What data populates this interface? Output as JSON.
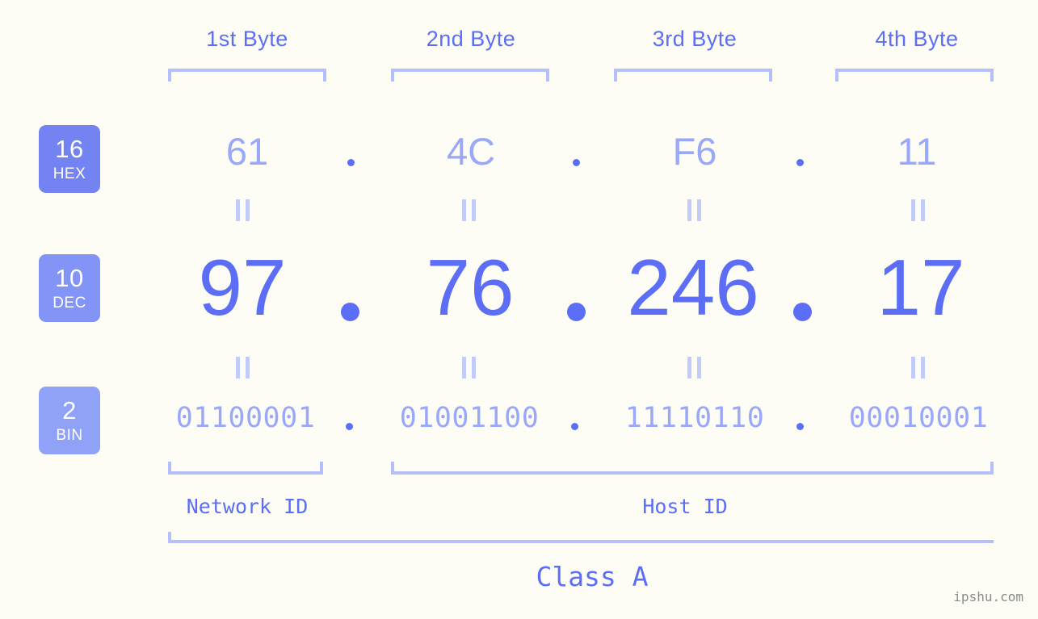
{
  "colors": {
    "background": "#fdfdf5",
    "accent_strong": "#5b6ef5",
    "accent_light": "#9aa8f9",
    "rule": "#b5c0fb",
    "badge_hex": "#7384f2",
    "badge_dec": "#8294f5",
    "badge_bin": "#90a2f8",
    "watermark": "#8b8b8b"
  },
  "header": {
    "byte_labels": [
      "1st Byte",
      "2nd Byte",
      "3rd Byte",
      "4th Byte"
    ]
  },
  "bases": [
    {
      "number": "16",
      "name": "HEX"
    },
    {
      "number": "10",
      "name": "DEC"
    },
    {
      "number": "2",
      "name": "BIN"
    }
  ],
  "rows": {
    "hex": {
      "base": "16",
      "label": "HEX",
      "octets": [
        "61",
        "4C",
        "F6",
        "11"
      ],
      "separator": "."
    },
    "dec": {
      "base": "10",
      "label": "DEC",
      "octets": [
        "97",
        "76",
        "246",
        "17"
      ],
      "separator": "."
    },
    "bin": {
      "base": "2",
      "label": "BIN",
      "octets": [
        "01100001",
        "01001100",
        "11110110",
        "00010001"
      ],
      "separator": "."
    }
  },
  "equals": {
    "glyph": "||",
    "count_per_gap": 4
  },
  "footer": {
    "network_id_label": "Network ID",
    "host_id_label": "Host ID",
    "class_label": "Class A"
  },
  "watermark": {
    "text": "ipshu.com"
  }
}
